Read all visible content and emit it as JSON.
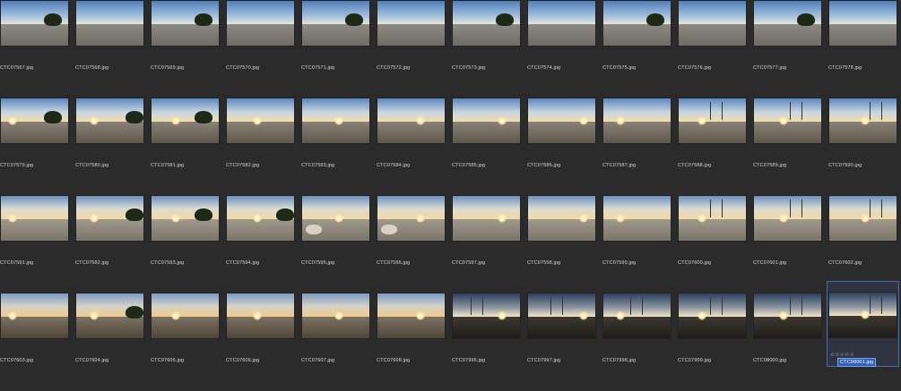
{
  "colors": {
    "background": "#2b2b2b",
    "selection": "#3f6fb4"
  },
  "selected_index": 47,
  "rows": [
    [
      "CTC07567.jpg",
      "CTC07568.jpg",
      "CTC07569.jpg",
      "CTC07570.jpg",
      "CTC07571.jpg",
      "CTC07572.jpg",
      "CTC07573.jpg",
      "CTC07574.jpg",
      "CTC07575.jpg",
      "CTC07576.jpg",
      "CTC07577.jpg",
      "CTC07578.jpg"
    ],
    [
      "CTC07579.jpg",
      "CTC07580.jpg",
      "CTC07581.jpg",
      "CTC07582.jpg",
      "CTC07583.jpg",
      "CTC07584.jpg",
      "CTC07585.jpg",
      "CTC07586.jpg",
      "CTC07587.jpg",
      "CTC07588.jpg",
      "CTC07589.jpg",
      "CTC07590.jpg"
    ],
    [
      "CTC07591.jpg",
      "CTC07592.jpg",
      "CTC07593.jpg",
      "CTC07594.jpg",
      "CTC07595.jpg",
      "CTC07596.jpg",
      "CTC07597.jpg",
      "CTC07598.jpg",
      "CTC07599.jpg",
      "CTC07600.jpg",
      "CTC07601.jpg",
      "CTC07602.jpg"
    ],
    [
      "CTC07603.jpg",
      "CTC07604.jpg",
      "CTC07605.jpg",
      "CTC07606.jpg",
      "CTC07607.jpg",
      "CTC07608.jpg",
      "CTC07996.jpg",
      "CTC07997.jpg",
      "CTC07998.jpg",
      "CTC07999.jpg",
      "CTC08000.jpg",
      "CTC08001.jpg"
    ]
  ],
  "rating_stars": "☆☆☆☆☆"
}
